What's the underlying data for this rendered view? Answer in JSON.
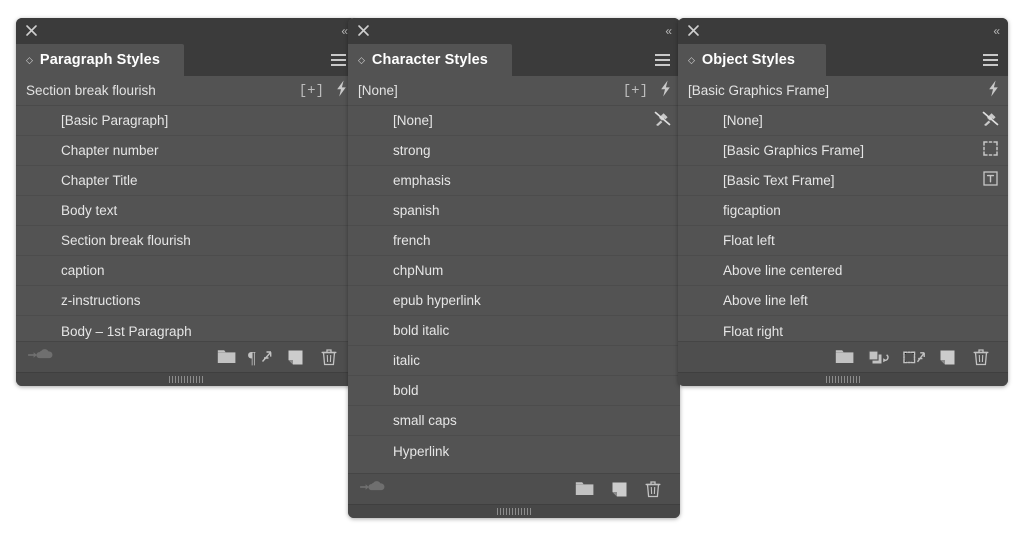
{
  "meta": {
    "app": "Adobe InDesign Styles Panels",
    "colors": {
      "panel_bg": "#535353",
      "header_bg": "#3b3b3b",
      "footer_bg": "#4e4e4e",
      "row_divider": "#4c4c4c",
      "text": "#e6e6e6",
      "icon": "#bdbdbd",
      "page_bg": "#ffffff"
    }
  },
  "panels": [
    {
      "id": "paragraph-styles",
      "titlebar": {
        "close_icon": "close-icon",
        "collapse_icon": "collapse-double-chevron-icon",
        "collapse_glyph": "«"
      },
      "tab": {
        "label": "Paragraph Styles",
        "diamond_glyph": "◇",
        "menu_icon": "panel-menu-icon"
      },
      "current": {
        "label": "Section break flourish",
        "icons": [
          {
            "name": "new-style-plus-icon",
            "glyph": "[+]",
            "type": "glyph"
          },
          {
            "name": "clear-overrides-bolt-icon",
            "type": "bolt"
          }
        ]
      },
      "items": [
        {
          "label": "[Basic Paragraph]",
          "icon": null
        },
        {
          "label": "Chapter number",
          "icon": null
        },
        {
          "label": "Chapter Title",
          "icon": null
        },
        {
          "label": "Body text",
          "icon": null
        },
        {
          "label": "Section break flourish",
          "icon": null
        },
        {
          "label": "caption",
          "icon": null
        },
        {
          "label": "z-instructions",
          "icon": null
        },
        {
          "label": "Body – 1st Paragraph",
          "icon": null
        }
      ],
      "footer": {
        "left_icon": {
          "name": "load-styles-cloud-icon",
          "type": "cloud"
        },
        "buttons": [
          {
            "name": "new-style-group-folder-button",
            "type": "folder"
          },
          {
            "name": "clear-overrides-pilcrow-button",
            "type": "pilcrow"
          },
          {
            "name": "new-style-button",
            "type": "newdoc"
          },
          {
            "name": "delete-style-trash-button",
            "type": "trash"
          }
        ]
      }
    },
    {
      "id": "character-styles",
      "titlebar": {
        "close_icon": "close-icon",
        "collapse_icon": "collapse-double-chevron-icon",
        "collapse_glyph": "«"
      },
      "tab": {
        "label": "Character Styles",
        "diamond_glyph": "◇",
        "menu_icon": "panel-menu-icon"
      },
      "current": {
        "label": "[None]",
        "icons": [
          {
            "name": "new-style-plus-icon",
            "glyph": "[+]",
            "type": "glyph"
          },
          {
            "name": "clear-overrides-bolt-icon",
            "type": "bolt"
          }
        ]
      },
      "items": [
        {
          "label": "[None]",
          "icon": "clear-attributes-brush-icon"
        },
        {
          "label": "strong",
          "icon": null
        },
        {
          "label": "emphasis",
          "icon": null
        },
        {
          "label": "spanish",
          "icon": null
        },
        {
          "label": "french",
          "icon": null
        },
        {
          "label": "chpNum",
          "icon": null
        },
        {
          "label": "epub hyperlink",
          "icon": null
        },
        {
          "label": "bold italic",
          "icon": null
        },
        {
          "label": "italic",
          "icon": null
        },
        {
          "label": "bold",
          "icon": null
        },
        {
          "label": "small caps",
          "icon": null
        },
        {
          "label": "Hyperlink",
          "icon": null
        }
      ],
      "footer": {
        "left_icon": {
          "name": "load-styles-cloud-icon",
          "type": "cloud"
        },
        "buttons": [
          {
            "name": "new-style-group-folder-button",
            "type": "folder"
          },
          {
            "name": "new-style-button",
            "type": "newdoc"
          },
          {
            "name": "delete-style-trash-button",
            "type": "trash"
          }
        ]
      }
    },
    {
      "id": "object-styles",
      "titlebar": {
        "close_icon": "close-icon",
        "collapse_icon": "collapse-double-chevron-icon",
        "collapse_glyph": "«"
      },
      "tab": {
        "label": "Object Styles",
        "diamond_glyph": "◇",
        "menu_icon": "panel-menu-icon"
      },
      "current": {
        "label": "[Basic Graphics Frame]",
        "icons": [
          {
            "name": "clear-overrides-bolt-icon",
            "type": "bolt"
          }
        ]
      },
      "items": [
        {
          "label": "[None]",
          "icon": "clear-attributes-brush-icon"
        },
        {
          "label": "[Basic Graphics Frame]",
          "icon": "graphics-frame-icon"
        },
        {
          "label": "[Basic Text Frame]",
          "icon": "text-frame-icon"
        },
        {
          "label": "figcaption",
          "icon": null
        },
        {
          "label": "Float left",
          "icon": null
        },
        {
          "label": "Above line centered",
          "icon": null
        },
        {
          "label": "Above line left",
          "icon": null
        },
        {
          "label": "Float right",
          "icon": null
        }
      ],
      "footer": {
        "left_icon": null,
        "buttons": [
          {
            "name": "new-style-group-folder-button",
            "type": "folder"
          },
          {
            "name": "clear-overrides-not-defined-button",
            "type": "overrides"
          },
          {
            "name": "clear-attributes-not-defined-button",
            "type": "attrs"
          },
          {
            "name": "new-style-button",
            "type": "newdoc"
          },
          {
            "name": "delete-style-trash-button",
            "type": "trash"
          }
        ]
      }
    }
  ]
}
